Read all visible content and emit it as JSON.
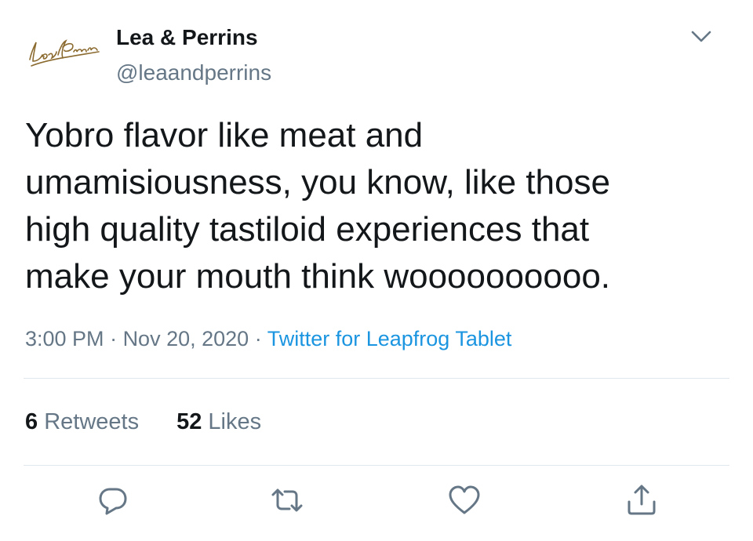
{
  "author": {
    "logo_text": "Lea & Perrins",
    "display_name": "Lea & Perrins",
    "handle": "@leaandperrins"
  },
  "tweet": {
    "text": "Yobro flavor like meat and\numamisiousness, you know, like those\nhigh quality tastiloid experiences that\nmake your mouth think woooooooooo."
  },
  "meta": {
    "time": "3:00 PM",
    "separator": " · ",
    "date": "Nov 20, 2020",
    "source": "Twitter for Leapfrog Tablet"
  },
  "stats": {
    "retweets_count": "6",
    "retweets_label": "Retweets",
    "likes_count": "52",
    "likes_label": "Likes"
  },
  "icons": {
    "menu": "chevron-down-icon",
    "reply": "reply-icon",
    "retweet": "retweet-icon",
    "like": "heart-icon",
    "share": "share-icon"
  },
  "colors": {
    "text": "#14171a",
    "secondary": "#657786",
    "link": "#1b95e0",
    "divider": "#e1e8ed",
    "logo": "#8b6a2f"
  }
}
